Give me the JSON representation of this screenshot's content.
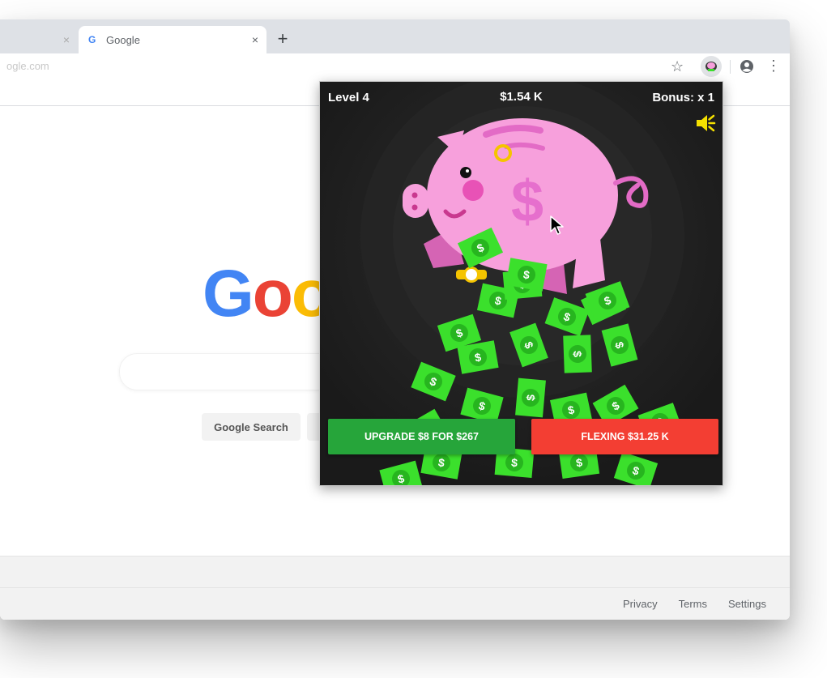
{
  "browser": {
    "faded_tab": {
      "close_label": "×"
    },
    "active_tab": {
      "favicon": "G",
      "title": "Google",
      "close_label": "×"
    },
    "new_tab_label": "+",
    "omnibox": {
      "url_fragment": "ogle.com"
    },
    "toolbar_icons": [
      "star-icon",
      "extension-pig-icon",
      "account-icon",
      "menu-icon"
    ]
  },
  "google_page": {
    "logo_letters": [
      "G",
      "o",
      "o"
    ],
    "logo_colors": [
      "#4285f4",
      "#ea4335",
      "#fbbc05"
    ],
    "search_button_label": "Google Search",
    "footer_links": [
      "Privacy",
      "Terms",
      "Settings"
    ]
  },
  "game": {
    "level_label": "Level 4",
    "money_label": "$1.54 K",
    "bonus_label": "Bonus: x 1",
    "pig_symbol": "$",
    "upgrade_button_label": "UPGRADE $8 FOR $267",
    "flex_button_label": "FLEXING $31.25 K",
    "colors": {
      "background": "#1f1f1f",
      "pig": "#f7a0dc",
      "pig_dark": "#e36bc6",
      "money": "#3be02c",
      "upgrade": "#26a53a",
      "flex": "#f33e33",
      "sound_icon": "#f5e000"
    },
    "sound_icon": "speaker-muted-icon"
  }
}
